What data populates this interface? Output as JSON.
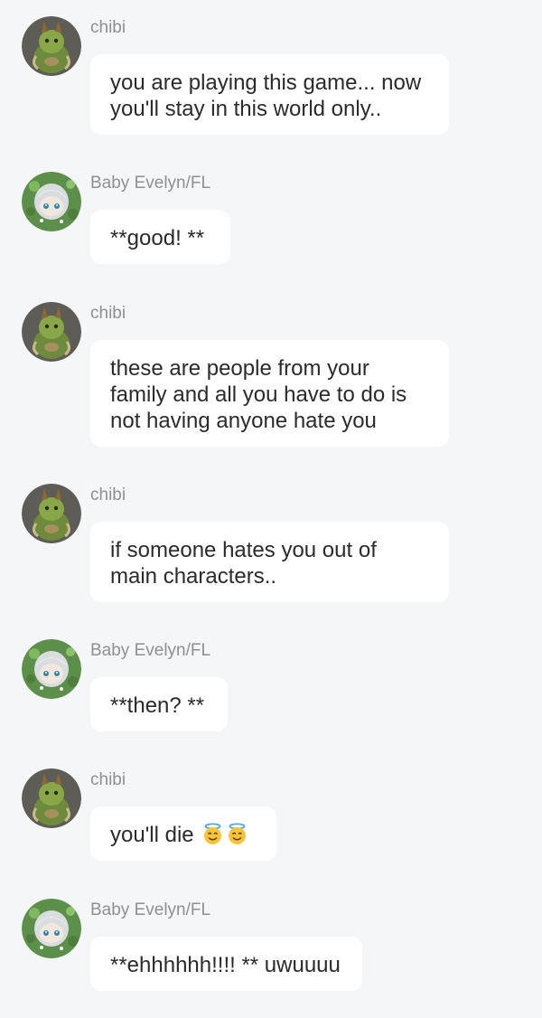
{
  "messages": [
    {
      "sender": "chibi",
      "text": "you are playing this game... now you'll stay in this world only..",
      "avatar": "chibi-avatar"
    },
    {
      "sender": "Baby Evelyn/FL",
      "text": "**good! **",
      "avatar": "evelyn-avatar"
    },
    {
      "sender": "chibi",
      "text": "these are people from your family and all you have to do is not having anyone hate you",
      "avatar": "chibi-avatar"
    },
    {
      "sender": "chibi",
      "text": "if someone hates you out of main characters..",
      "avatar": "chibi-avatar"
    },
    {
      "sender": "Baby Evelyn/FL",
      "text": "**then? **",
      "avatar": "evelyn-avatar"
    },
    {
      "sender": "chibi",
      "text": "you'll die",
      "emoji": "smiling-face-with-halo-icon",
      "avatar": "chibi-avatar"
    },
    {
      "sender": "Baby Evelyn/FL",
      "text": "**ehhhhhh!!!! ** uwuuuu",
      "avatar": "evelyn-avatar"
    }
  ],
  "colors": {
    "background": "#f5f6f8",
    "bubble": "#ffffff",
    "sender_name": "#8f8f94",
    "message_text": "#2b2b2b"
  }
}
